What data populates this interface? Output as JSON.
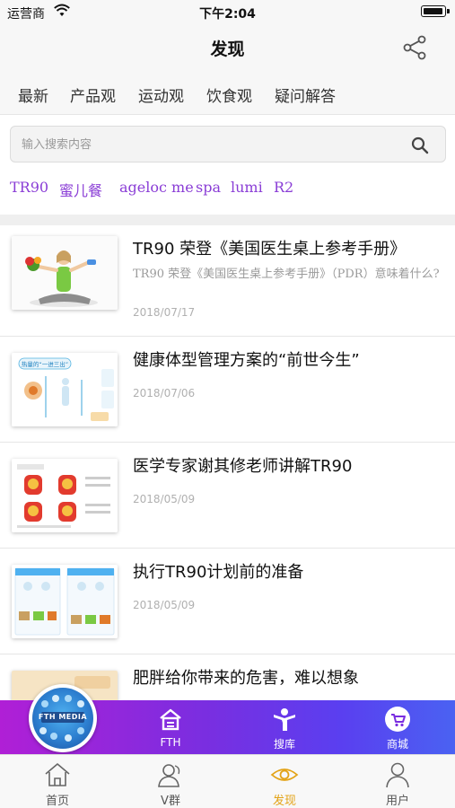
{
  "status_bar": {
    "carrier": "运营商",
    "time": "下午2:04"
  },
  "nav": {
    "title": "发现"
  },
  "tabs": [
    {
      "label": "最新"
    },
    {
      "label": "产品观"
    },
    {
      "label": "运动观"
    },
    {
      "label": "饮食观"
    },
    {
      "label": "疑问解答"
    }
  ],
  "search": {
    "placeholder": "输入搜索内容",
    "value": ""
  },
  "tags": [
    {
      "label": "TR90"
    },
    {
      "label": "蜜儿餐"
    },
    {
      "label": "ageloc me"
    },
    {
      "label": "spa"
    },
    {
      "label": "lumi"
    },
    {
      "label": "R2"
    }
  ],
  "articles": [
    {
      "title": "TR90 荣登《美国医生桌上参考手册》",
      "summary": "TR90 荣登《美国医生桌上参考手册》（PDR）意味着什么?",
      "date": "2018/07/17"
    },
    {
      "title": "健康体型管理方案的“前世今生”",
      "summary": "",
      "date": "2018/07/06"
    },
    {
      "title": "医学专家谢其修老师讲解TR90",
      "summary": "",
      "date": "2018/05/09"
    },
    {
      "title": "执行TR90计划前的准备",
      "summary": "",
      "date": "2018/05/09"
    },
    {
      "title": "肥胖给你带来的危害，难以想象",
      "summary": "",
      "date": ""
    }
  ],
  "thumb_texts": {
    "article2_caption": "热量的“一进三出”"
  },
  "banner": {
    "badge_label": "FTH MEDIA",
    "items": [
      {
        "label": "FTH",
        "icon": "home-icon"
      },
      {
        "label": "搜库",
        "icon": "person-icon"
      },
      {
        "label": "商城",
        "icon": "cart-icon"
      }
    ]
  },
  "tab_bar": {
    "items": [
      {
        "label": "首页",
        "icon": "home-outline-icon",
        "active": false
      },
      {
        "label": "V群",
        "icon": "group-icon",
        "active": false
      },
      {
        "label": "发现",
        "icon": "eye-icon",
        "active": true
      },
      {
        "label": "用户",
        "icon": "user-icon",
        "active": false
      }
    ]
  },
  "colors": {
    "accent": "#8a3dd6",
    "active_tab": "#e3a317",
    "banner_start": "#b01fd6",
    "banner_end": "#4a62f2"
  }
}
